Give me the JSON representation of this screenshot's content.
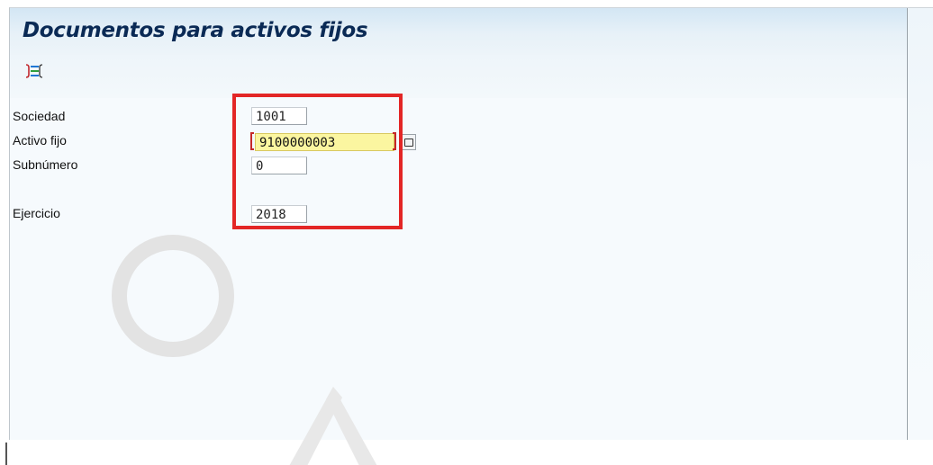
{
  "window": {
    "title": "Documentos para activos fijos"
  },
  "toolbar": {
    "icons": [
      "multiple-selection-icon"
    ]
  },
  "form": {
    "fields": [
      {
        "label": "Sociedad",
        "value": "1001"
      },
      {
        "label": "Activo fijo",
        "value": "9100000003",
        "focused": true,
        "has_search_help": true
      },
      {
        "label": "Subnúmero",
        "value": "0"
      },
      {
        "label": "Ejercicio",
        "value": "2018"
      }
    ]
  },
  "colors": {
    "highlight": "#e32626",
    "active_field": "#fbf6a0",
    "title": "#0a2a55"
  }
}
